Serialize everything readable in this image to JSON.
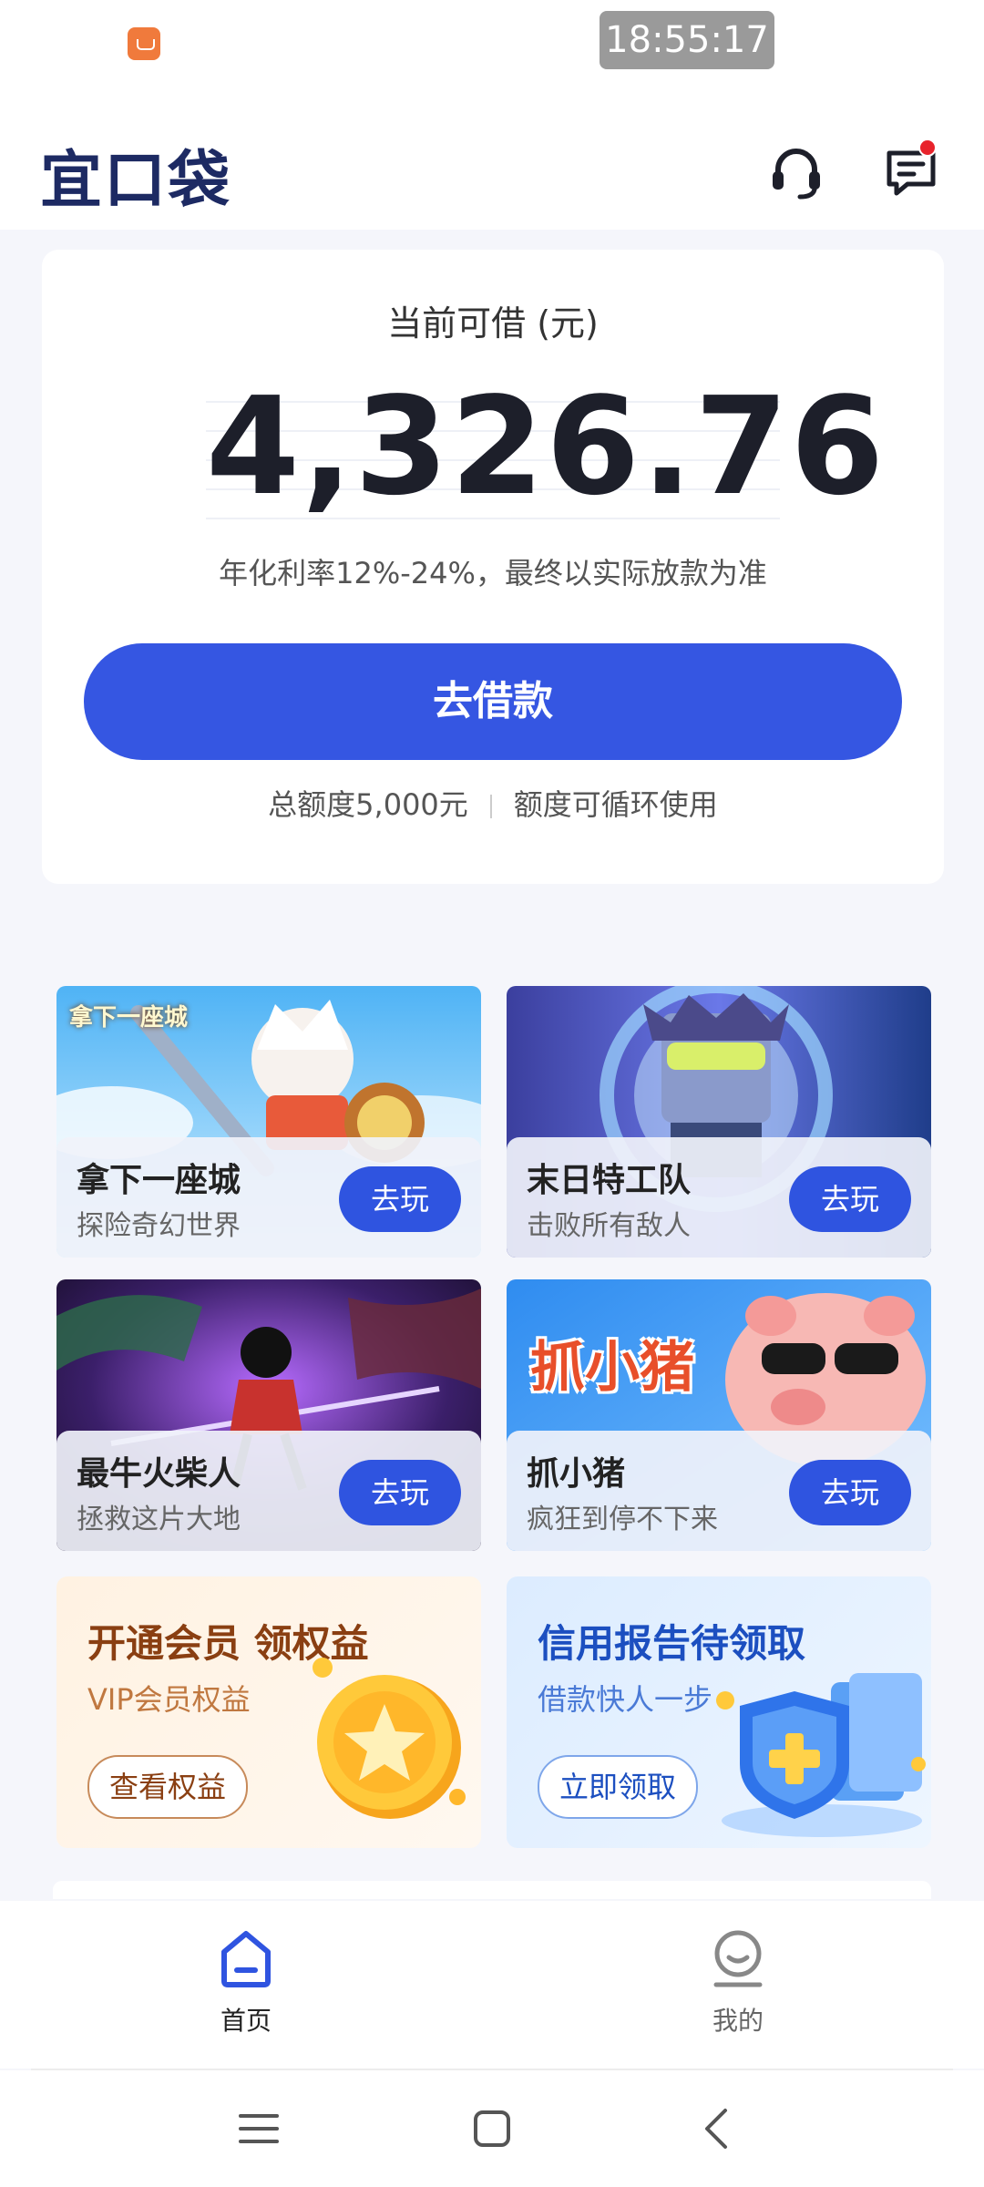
{
  "status_bar": {
    "time": "18:55:17"
  },
  "header": {
    "logo": "宜口袋",
    "has_notification": true,
    "colors": {
      "brand": "#1d2a63",
      "notification": "#e8232b"
    }
  },
  "loan": {
    "caption": "当前可借 (元)",
    "amount": "4,326.76",
    "rate_note": "年化利率12%-24%，最终以实际放款为准",
    "cta": "去借款",
    "total_limit": "总额度5,000元",
    "limit_note": "额度可循环使用",
    "colors": {
      "primary": "#3556e2"
    }
  },
  "games": [
    {
      "title": "拿下一座城",
      "subtitle": "探险奇幻世界",
      "play_label": "去玩",
      "art_label": "拿下一座城"
    },
    {
      "title": "末日特工队",
      "subtitle": "击败所有敌人",
      "play_label": "去玩"
    },
    {
      "title": "最牛火柴人",
      "subtitle": "拯救这片大地",
      "play_label": "去玩"
    },
    {
      "title": "抓小猪",
      "subtitle": "疯狂到停不下来",
      "play_label": "去玩",
      "art_label": "抓小猪"
    }
  ],
  "promos": [
    {
      "title": "开通会员 领权益",
      "subtitle": "VIP会员权益",
      "button": "查看权益",
      "icon": "star-coin-icon"
    },
    {
      "title": "信用报告待领取",
      "subtitle": "借款快人一步",
      "button": "立即领取",
      "icon": "shield-icon"
    }
  ],
  "bottom_nav": [
    {
      "label": "首页",
      "icon": "home-icon",
      "active": true
    },
    {
      "label": "我的",
      "icon": "profile-icon",
      "active": false
    }
  ],
  "system_nav": [
    "menu-icon",
    "home-square-icon",
    "back-icon"
  ]
}
